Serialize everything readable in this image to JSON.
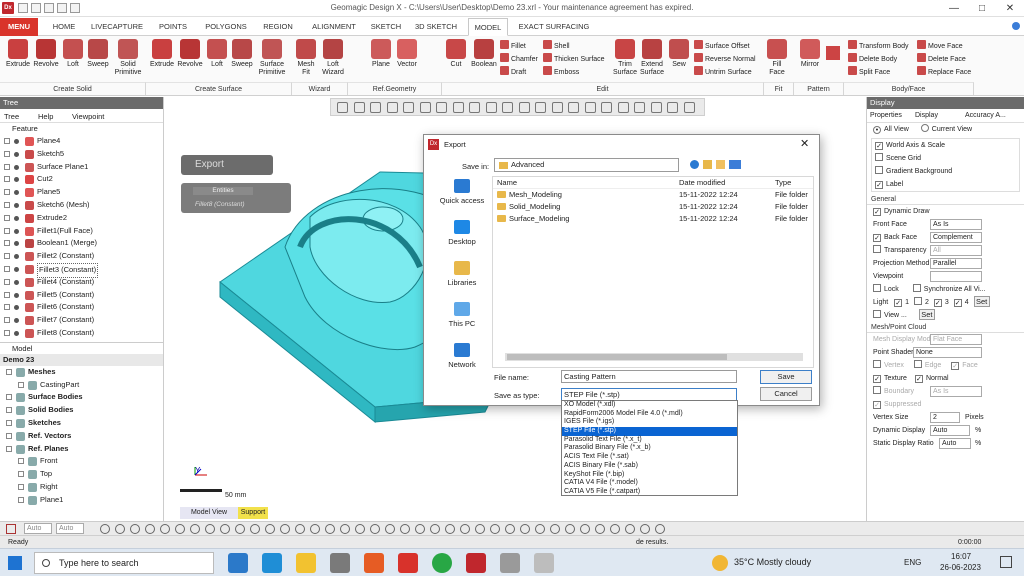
{
  "titlebar": {
    "text": "Geomagic Design X - C:\\Users\\User\\Desktop\\Demo 23.xrl - Your maintenance agreement has expired.",
    "app_icon": "Dx"
  },
  "tabs": [
    "MENU",
    "HOME",
    "LIVECAPTURE",
    "POINTS",
    "POLYGONS",
    "REGION",
    "ALIGNMENT",
    "SKETCH",
    "3D SKETCH",
    "MODEL",
    "EXACT SURFACING"
  ],
  "active_tab": "MODEL",
  "ribbon": {
    "create_solid": [
      "Extrude",
      "Revolve",
      "Loft",
      "Sweep",
      "Solid Primitive"
    ],
    "create_surface": [
      "Extrude",
      "Revolve",
      "Loft",
      "Sweep",
      "Surface Primitive"
    ],
    "wizard": [
      "Mesh Fit",
      "Loft Wizard"
    ],
    "refgeom": [
      "Plane",
      "Vector"
    ],
    "edit_big": [
      "Cut",
      "Boolean"
    ],
    "edit_small1": [
      "Fillet",
      "Chamfer",
      "Draft"
    ],
    "edit_small2": [
      "Shell",
      "Thicken Surface",
      "Emboss"
    ],
    "edit_big2": [
      "Trim Surface",
      "Extend Surface",
      "Sew"
    ],
    "edit_small3": [
      "Surface Offset",
      "Reverse Normal",
      "Untrim Surface"
    ],
    "fit": [
      "Fill Face"
    ],
    "pattern": [
      "Mirror"
    ],
    "body_small1": [
      "Transform Body",
      "Delete Body",
      "Split Face"
    ],
    "body_small2": [
      "Move Face",
      "Delete Face",
      "Replace Face"
    ],
    "groups": [
      "Create Solid",
      "Create Surface",
      "Wizard",
      "Ref.Geometry",
      "Edit",
      "Fit",
      "Pattern",
      "Body/Face"
    ]
  },
  "left_panel": {
    "header": "Tree",
    "tabs": [
      "Tree",
      "Help",
      "Viewpoint"
    ],
    "feature_label": "Feature",
    "features": [
      "Plane4",
      "Sketch5",
      "Surface Plane1",
      "Cut2",
      "Plane5",
      "Sketch6 (Mesh)",
      "Extrude2",
      "Fillet1(Full Face)",
      "Boolean1 (Merge)",
      "Fillet2 (Constant)",
      "Fillet3 (Constant)",
      "Fillet4 (Constant)",
      "Fillet5 (Constant)",
      "Fillet6 (Constant)",
      "Fillet7 (Constant)",
      "Fillet8 (Constant)"
    ],
    "model_label": "Model",
    "model_root": "Demo 23",
    "model_items": [
      "Meshes",
      "CastingPart",
      "Surface Bodies",
      "Solid Bodies",
      "Sketches",
      "Ref. Vectors",
      "Ref. Planes",
      "Front",
      "Top",
      "Right",
      "Plane1"
    ]
  },
  "viewport": {
    "export_overlay": "Export",
    "entities_label": "Entities",
    "entity_item": "Fillet8 (Constant)",
    "scale_label": "50 mm",
    "tabs": [
      "Model View",
      "Support"
    ]
  },
  "right_panel": {
    "header": "Display",
    "tabs": [
      "Properties",
      "Display",
      "Accuracy A..."
    ],
    "view_options": [
      "All View",
      "Current View"
    ],
    "checks": [
      "World Axis & Scale",
      "Scene Grid",
      "Gradient Background",
      "Label"
    ],
    "general": "General",
    "dynamic_draw": "Dynamic Draw",
    "front_face": "Front Face",
    "front_face_val": "As Is",
    "back_face": "Back Face",
    "back_face_val": "Complement",
    "transparency": "Transparency",
    "transparency_val": "All",
    "projection": "Projection Method",
    "projection_val": "Parallel",
    "viewpoint": "Viewpoint",
    "lock": "Lock",
    "sync": "Synchronize All Vi...",
    "light": "Light",
    "light_nums": [
      "1",
      "2",
      "3",
      "4"
    ],
    "set": "Set",
    "view": "View ...",
    "mesh_point_cloud": "Mesh/Point Cloud",
    "mesh_display_mode": "Mesh Display Mode",
    "mesh_display_val": "Flat Face",
    "point_shader": "Point Shader",
    "point_shader_val": "None",
    "vertex": "Vertex",
    "edge": "Edge",
    "face": "Face",
    "texture": "Texture",
    "normal": "Normal",
    "boundary": "Boundary",
    "boundary_val": "As Is",
    "suppressed": "Suppressed",
    "vertex_size": "Vertex Size",
    "vertex_size_val": "2",
    "pixels": "Pixels",
    "dynamic_display": "Dynamic Display",
    "dynamic_display_val": "Auto",
    "static_display": "Static Display Ratio",
    "static_display_val": "Auto",
    "pct": "%"
  },
  "dialog": {
    "title": "Export",
    "save_in_label": "Save in:",
    "save_in_value": "Advanced",
    "places": [
      "Quick access",
      "Desktop",
      "Libraries",
      "This PC",
      "Network"
    ],
    "columns": [
      "Name",
      "Date modified",
      "Type"
    ],
    "files": [
      {
        "name": "Mesh_Modeling",
        "date": "15-11-2022 12:24",
        "type": "File folder"
      },
      {
        "name": "Solid_Modeling",
        "date": "15-11-2022 12:24",
        "type": "File folder"
      },
      {
        "name": "Surface_Modeling",
        "date": "15-11-2022 12:24",
        "type": "File folder"
      }
    ],
    "file_name_label": "File name:",
    "file_name_value": "Casting Pattern",
    "save_type_label": "Save as type:",
    "save_type_value": "STEP File (*.stp)",
    "save_button": "Save",
    "cancel_button": "Cancel",
    "options": [
      "XO Model (*.xdl)",
      "RapidForm2006 Model File 4.0 (*.mdl)",
      "IGES File (*.igs)",
      "STEP File (*.stp)",
      "Parasolid Text File (*.x_t)",
      "Parasolid Binary File (*.x_b)",
      "ACIS Text File (*.sat)",
      "ACIS Binary File (*.sab)",
      "KeyShot File (*.bip)",
      "CATIA V4 File (*.model)",
      "CATIA V5 File (*.catpart)"
    ],
    "selected_option_index": 3
  },
  "bottom_toolbar": {
    "auto1": "Auto",
    "auto2": "Auto"
  },
  "status": {
    "left": "Ready",
    "center": "de results.",
    "time": "0:00:00"
  },
  "taskbar": {
    "search": "Type here to search",
    "weather": "35°C  Mostly cloudy",
    "lang": "ENG",
    "time": "16:07",
    "date": "26-06-2023"
  }
}
